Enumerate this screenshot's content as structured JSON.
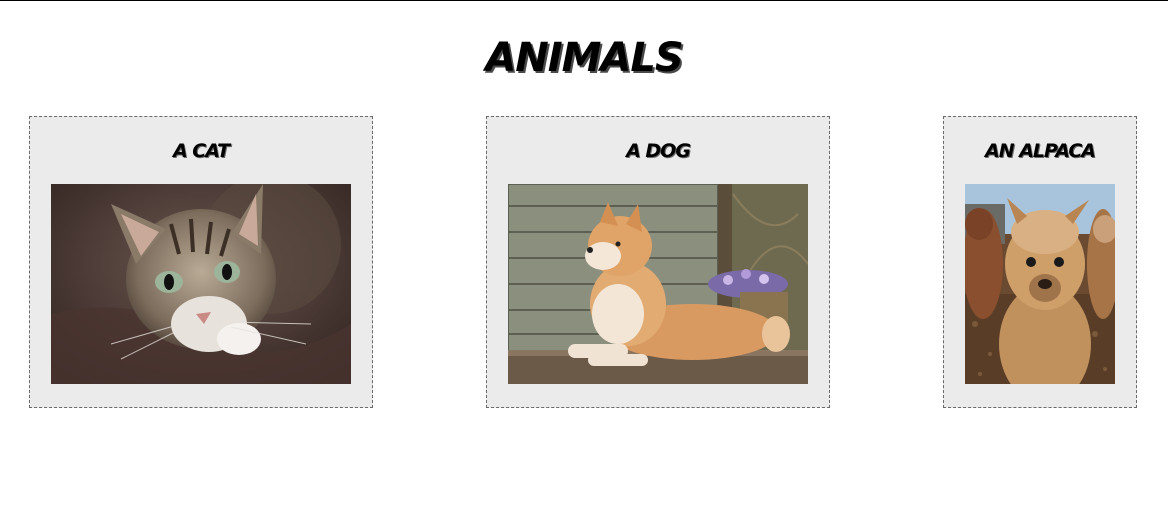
{
  "page": {
    "title": "ANIMALS"
  },
  "cards": [
    {
      "title": "A CAT",
      "image": "cat-photo"
    },
    {
      "title": "A DOG",
      "image": "dog-photo"
    },
    {
      "title": "AN ALPACA",
      "image": "alpaca-photo"
    }
  ],
  "colors": {
    "background": "#ffffff",
    "card_background": "#ebebeb",
    "card_border": "#6a6a6a",
    "text": "#000000"
  }
}
